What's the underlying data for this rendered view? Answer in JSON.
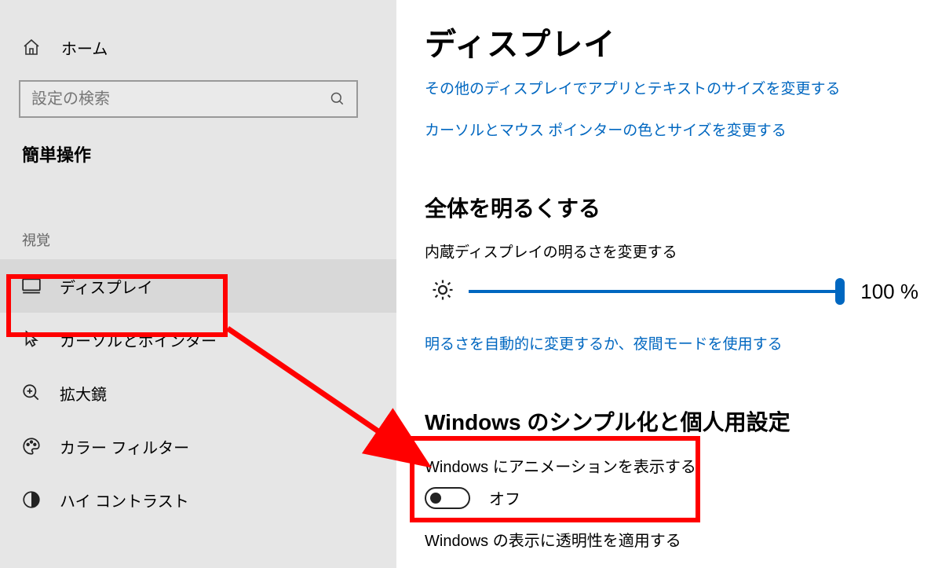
{
  "sidebar": {
    "home_label": "ホーム",
    "search_placeholder": "設定の検索",
    "category": "簡単操作",
    "group": "視覚",
    "items": [
      {
        "label": "ディスプレイ"
      },
      {
        "label": "カーソルとポインター"
      },
      {
        "label": "拡大鏡"
      },
      {
        "label": "カラー フィルター"
      },
      {
        "label": "ハイ コントラスト"
      }
    ]
  },
  "main": {
    "title": "ディスプレイ",
    "link_truncated": "その他のディスプレイでアプリとテキストのサイズを変更する",
    "link_cursor": "カーソルとマウス ポインターの色とサイズを変更する",
    "section_brightness": "全体を明るくする",
    "brightness_subtext": "内蔵ディスプレイの明るさを変更する",
    "brightness_value": "100 %",
    "link_auto_brightness": "明るさを自動的に変更するか、夜間モードを使用する",
    "section_simplify": "Windows のシンプル化と個人用設定",
    "setting_animations_label": "Windows にアニメーションを表示する",
    "setting_animations_state": "オフ",
    "setting_transparency_label": "Windows の表示に透明性を適用する"
  }
}
